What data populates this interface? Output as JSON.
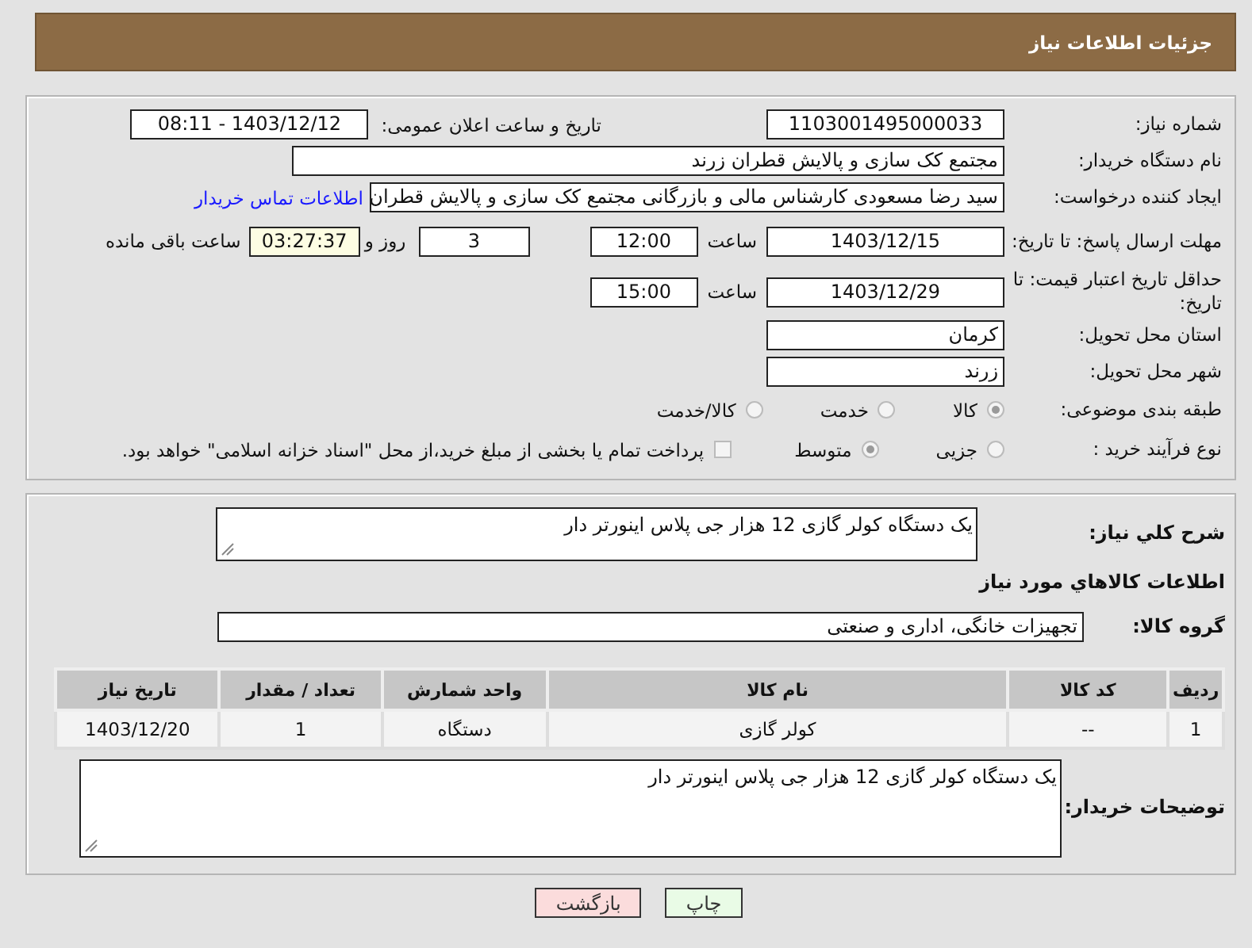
{
  "header": {
    "title": "جزئیات اطلاعات نیاز"
  },
  "need_number": {
    "label": "شماره نیاز:",
    "value": "1103001495000033"
  },
  "announce": {
    "label": "تاریخ و ساعت اعلان عمومی:",
    "value": "1403/12/12 - 08:11"
  },
  "buyer_org": {
    "label": "نام دستگاه خریدار:",
    "value": "مجتمع کک سازی و پالایش قطران زرند"
  },
  "requester": {
    "label": "ایجاد کننده درخواست:",
    "value": "سید رضا مسعودی کارشناس مالی و بازرگانی مجتمع کک سازی و پالایش قطران",
    "contact_link": "اطلاعات تماس خریدار"
  },
  "reply_deadline": {
    "label": "مهلت ارسال پاسخ: تا تاریخ:",
    "date": "1403/12/15",
    "time_label": "ساعت",
    "time": "12:00",
    "days": "3",
    "days_label": "روز و",
    "remaining": "03:27:37",
    "remaining_label": "ساعت باقی مانده"
  },
  "price_validity": {
    "label": "حداقل تاریخ اعتبار قیمت: تا تاریخ:",
    "date": "1403/12/29",
    "time_label": "ساعت",
    "time": "15:00"
  },
  "province": {
    "label": "استان محل تحویل:",
    "value": "کرمان"
  },
  "city": {
    "label": "شهر محل تحویل:",
    "value": "زرند"
  },
  "category": {
    "label": "طبقه بندی موضوعی:",
    "options": [
      {
        "label": "کالا",
        "selected": true
      },
      {
        "label": "خدمت",
        "selected": false
      },
      {
        "label": "کالا/خدمت",
        "selected": false
      }
    ]
  },
  "process": {
    "label": "نوع فرآیند خرید :",
    "options": [
      {
        "label": "جزیی",
        "selected": false
      },
      {
        "label": "متوسط",
        "selected": true
      }
    ],
    "payment": {
      "checked": false,
      "label": "پرداخت تمام یا بخشی از مبلغ خرید،از محل \"اسناد خزانه اسلامی\" خواهد بود."
    }
  },
  "summary": {
    "label": "شرح کلي نياز:",
    "value": "یک دستگاه کولر گازی 12 هزار جی پلاس اینورتر دار"
  },
  "goods_heading": "اطلاعات کالاهاي مورد نياز",
  "goods_group": {
    "label": "گروه کالا:",
    "value": "تجهیزات خانگی، اداری و صنعتی"
  },
  "table": {
    "columns": [
      "ردیف",
      "کد کالا",
      "نام کالا",
      "واحد شمارش",
      "تعداد / مقدار",
      "تاریخ نیاز"
    ],
    "rows": [
      [
        "1",
        "--",
        "کولر گازی",
        "دستگاه",
        "1",
        "1403/12/20"
      ]
    ]
  },
  "buyer_notes": {
    "label": "توضیحات خریدار:",
    "value": "یک دستگاه کولر گازی 12 هزار جی پلاس اینورتر دار"
  },
  "buttons": [
    {
      "label": "چاپ",
      "kind": "print"
    },
    {
      "label": "بازگشت",
      "kind": "back"
    }
  ]
}
